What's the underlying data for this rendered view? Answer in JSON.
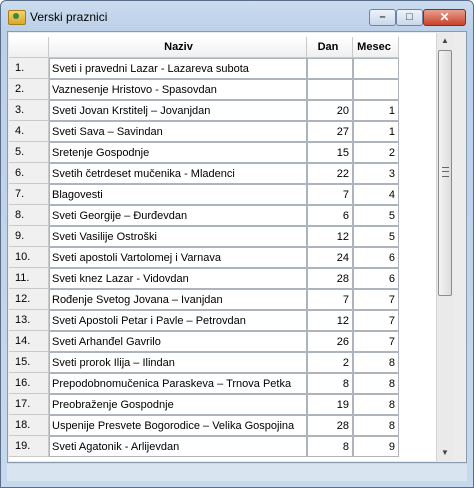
{
  "window": {
    "title": "Verski praznici",
    "icon": "app-icon",
    "buttons": {
      "minimize": "–",
      "maximize": "□",
      "close": "✕"
    }
  },
  "table": {
    "columns": [
      "",
      "Naziv",
      "Dan",
      "Mesec"
    ],
    "rows": [
      {
        "num": "1.",
        "naziv": "Sveti i pravedni Lazar - Lazareva subota",
        "dan": "",
        "mesec": ""
      },
      {
        "num": "2.",
        "naziv": "Vaznesenje Hristovo - Spasovdan",
        "dan": "",
        "mesec": ""
      },
      {
        "num": "3.",
        "naziv": "Sveti Jovan Krstitelj – Jovanjdan",
        "dan": "20",
        "mesec": "1"
      },
      {
        "num": "4.",
        "naziv": "Sveti Sava – Savindan",
        "dan": "27",
        "mesec": "1"
      },
      {
        "num": "5.",
        "naziv": "Sretenje Gospodnje",
        "dan": "15",
        "mesec": "2"
      },
      {
        "num": "6.",
        "naziv": "Svetih četrdeset mučenika - Mladenci",
        "dan": "22",
        "mesec": "3"
      },
      {
        "num": "7.",
        "naziv": "Blagovesti",
        "dan": "7",
        "mesec": "4"
      },
      {
        "num": "8.",
        "naziv": "Sveti Georgije – Đurđevdan",
        "dan": "6",
        "mesec": "5"
      },
      {
        "num": "9.",
        "naziv": "Sveti Vasilije Ostroški",
        "dan": "12",
        "mesec": "5"
      },
      {
        "num": "10.",
        "naziv": "Sveti apostoli Vartolomej i Varnava",
        "dan": "24",
        "mesec": "6"
      },
      {
        "num": "11.",
        "naziv": "Sveti knez Lazar - Vidovdan",
        "dan": "28",
        "mesec": "6"
      },
      {
        "num": "12.",
        "naziv": "Rođenje Svetog Jovana – Ivanjdan",
        "dan": "7",
        "mesec": "7"
      },
      {
        "num": "13.",
        "naziv": "Sveti Apostoli Petar i Pavle – Petrovdan",
        "dan": "12",
        "mesec": "7"
      },
      {
        "num": "14.",
        "naziv": "Sveti Arhanđel Gavrilo",
        "dan": "26",
        "mesec": "7"
      },
      {
        "num": "15.",
        "naziv": "Sveti prorok Ilija – Ilindan",
        "dan": "2",
        "mesec": "8"
      },
      {
        "num": "16.",
        "naziv": "Prepodobnomučenica Paraskeva – Trnova Petka",
        "dan": "8",
        "mesec": "8"
      },
      {
        "num": "17.",
        "naziv": "Preobraženje Gospodnje",
        "dan": "19",
        "mesec": "8"
      },
      {
        "num": "18.",
        "naziv": "Uspenije Presvete Bogorodice – Velika Gospojina",
        "dan": "28",
        "mesec": "8"
      },
      {
        "num": "19.",
        "naziv": "Sveti Agatonik - Arlijevdan",
        "dan": "8",
        "mesec": "9"
      }
    ]
  },
  "scrollbar": {
    "up": "▲",
    "down": "▼"
  }
}
